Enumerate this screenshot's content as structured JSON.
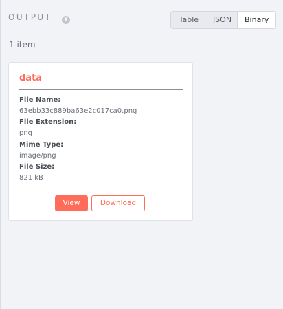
{
  "header": {
    "title": "OUTPUT",
    "info_icon": "info-icon"
  },
  "view_toggle": {
    "options": [
      "Table",
      "JSON",
      "Binary"
    ],
    "selected": "Binary"
  },
  "summary": {
    "count_text": "1 item"
  },
  "card": {
    "title": "data",
    "fields": [
      {
        "label": "File Name:",
        "value": "63ebb33c889ba63e2c017ca0.png"
      },
      {
        "label": "File Extension:",
        "value": "png"
      },
      {
        "label": "Mime Type:",
        "value": "image/png"
      },
      {
        "label": "File Size:",
        "value": "821 kB"
      }
    ],
    "view_label": "View",
    "download_label": "Download"
  },
  "colors": {
    "accent": "#ff6d5a",
    "background": "#f2f3f7"
  }
}
